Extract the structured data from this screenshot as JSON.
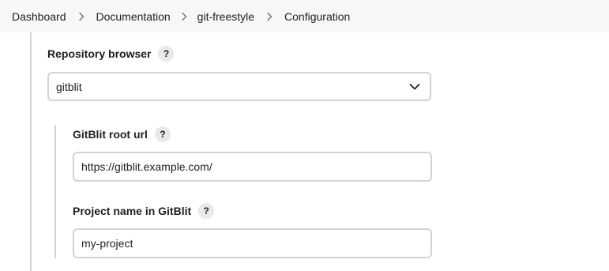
{
  "breadcrumb": {
    "items": [
      {
        "label": "Dashboard"
      },
      {
        "label": "Documentation"
      },
      {
        "label": "git-freestyle"
      },
      {
        "label": "Configuration"
      }
    ],
    "separator_icon": "chevron-right-icon"
  },
  "repository_browser": {
    "label": "Repository browser",
    "help": "?",
    "selected_value": "gitblit",
    "dropdown_icon": "chevron-down-icon"
  },
  "gitblit": {
    "root_url": {
      "label": "GitBlit root url",
      "help": "?",
      "value": "https://gitblit.example.com/"
    },
    "project_name": {
      "label": "Project name in GitBlit",
      "help": "?",
      "value": "my-project"
    }
  }
}
